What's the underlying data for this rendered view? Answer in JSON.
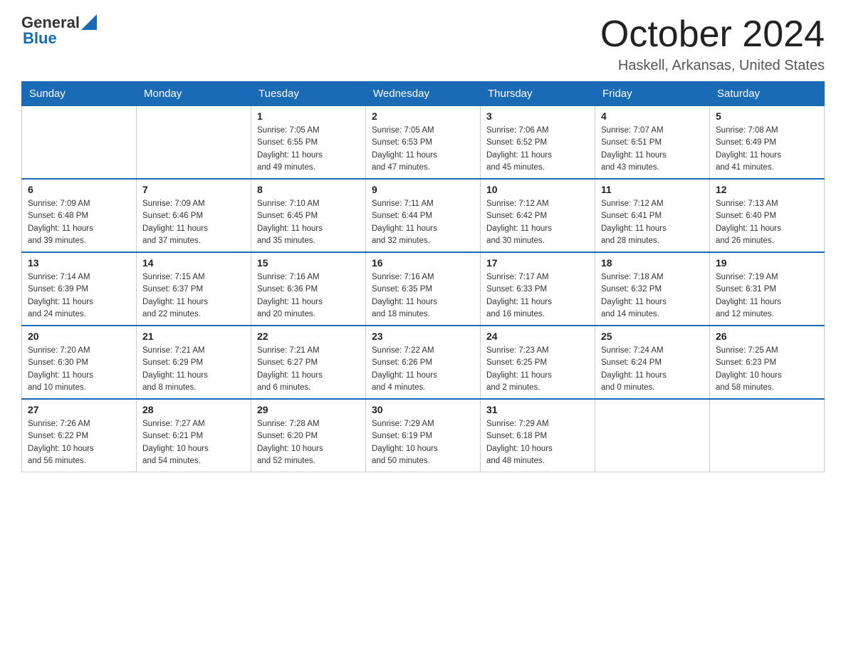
{
  "header": {
    "logo_general": "General",
    "logo_blue": "Blue",
    "month_year": "October 2024",
    "location": "Haskell, Arkansas, United States"
  },
  "weekdays": [
    "Sunday",
    "Monday",
    "Tuesday",
    "Wednesday",
    "Thursday",
    "Friday",
    "Saturday"
  ],
  "weeks": [
    [
      {
        "day": "",
        "info": ""
      },
      {
        "day": "",
        "info": ""
      },
      {
        "day": "1",
        "info": "Sunrise: 7:05 AM\nSunset: 6:55 PM\nDaylight: 11 hours\nand 49 minutes."
      },
      {
        "day": "2",
        "info": "Sunrise: 7:05 AM\nSunset: 6:53 PM\nDaylight: 11 hours\nand 47 minutes."
      },
      {
        "day": "3",
        "info": "Sunrise: 7:06 AM\nSunset: 6:52 PM\nDaylight: 11 hours\nand 45 minutes."
      },
      {
        "day": "4",
        "info": "Sunrise: 7:07 AM\nSunset: 6:51 PM\nDaylight: 11 hours\nand 43 minutes."
      },
      {
        "day": "5",
        "info": "Sunrise: 7:08 AM\nSunset: 6:49 PM\nDaylight: 11 hours\nand 41 minutes."
      }
    ],
    [
      {
        "day": "6",
        "info": "Sunrise: 7:09 AM\nSunset: 6:48 PM\nDaylight: 11 hours\nand 39 minutes."
      },
      {
        "day": "7",
        "info": "Sunrise: 7:09 AM\nSunset: 6:46 PM\nDaylight: 11 hours\nand 37 minutes."
      },
      {
        "day": "8",
        "info": "Sunrise: 7:10 AM\nSunset: 6:45 PM\nDaylight: 11 hours\nand 35 minutes."
      },
      {
        "day": "9",
        "info": "Sunrise: 7:11 AM\nSunset: 6:44 PM\nDaylight: 11 hours\nand 32 minutes."
      },
      {
        "day": "10",
        "info": "Sunrise: 7:12 AM\nSunset: 6:42 PM\nDaylight: 11 hours\nand 30 minutes."
      },
      {
        "day": "11",
        "info": "Sunrise: 7:12 AM\nSunset: 6:41 PM\nDaylight: 11 hours\nand 28 minutes."
      },
      {
        "day": "12",
        "info": "Sunrise: 7:13 AM\nSunset: 6:40 PM\nDaylight: 11 hours\nand 26 minutes."
      }
    ],
    [
      {
        "day": "13",
        "info": "Sunrise: 7:14 AM\nSunset: 6:39 PM\nDaylight: 11 hours\nand 24 minutes."
      },
      {
        "day": "14",
        "info": "Sunrise: 7:15 AM\nSunset: 6:37 PM\nDaylight: 11 hours\nand 22 minutes."
      },
      {
        "day": "15",
        "info": "Sunrise: 7:16 AM\nSunset: 6:36 PM\nDaylight: 11 hours\nand 20 minutes."
      },
      {
        "day": "16",
        "info": "Sunrise: 7:16 AM\nSunset: 6:35 PM\nDaylight: 11 hours\nand 18 minutes."
      },
      {
        "day": "17",
        "info": "Sunrise: 7:17 AM\nSunset: 6:33 PM\nDaylight: 11 hours\nand 16 minutes."
      },
      {
        "day": "18",
        "info": "Sunrise: 7:18 AM\nSunset: 6:32 PM\nDaylight: 11 hours\nand 14 minutes."
      },
      {
        "day": "19",
        "info": "Sunrise: 7:19 AM\nSunset: 6:31 PM\nDaylight: 11 hours\nand 12 minutes."
      }
    ],
    [
      {
        "day": "20",
        "info": "Sunrise: 7:20 AM\nSunset: 6:30 PM\nDaylight: 11 hours\nand 10 minutes."
      },
      {
        "day": "21",
        "info": "Sunrise: 7:21 AM\nSunset: 6:29 PM\nDaylight: 11 hours\nand 8 minutes."
      },
      {
        "day": "22",
        "info": "Sunrise: 7:21 AM\nSunset: 6:27 PM\nDaylight: 11 hours\nand 6 minutes."
      },
      {
        "day": "23",
        "info": "Sunrise: 7:22 AM\nSunset: 6:26 PM\nDaylight: 11 hours\nand 4 minutes."
      },
      {
        "day": "24",
        "info": "Sunrise: 7:23 AM\nSunset: 6:25 PM\nDaylight: 11 hours\nand 2 minutes."
      },
      {
        "day": "25",
        "info": "Sunrise: 7:24 AM\nSunset: 6:24 PM\nDaylight: 11 hours\nand 0 minutes."
      },
      {
        "day": "26",
        "info": "Sunrise: 7:25 AM\nSunset: 6:23 PM\nDaylight: 10 hours\nand 58 minutes."
      }
    ],
    [
      {
        "day": "27",
        "info": "Sunrise: 7:26 AM\nSunset: 6:22 PM\nDaylight: 10 hours\nand 56 minutes."
      },
      {
        "day": "28",
        "info": "Sunrise: 7:27 AM\nSunset: 6:21 PM\nDaylight: 10 hours\nand 54 minutes."
      },
      {
        "day": "29",
        "info": "Sunrise: 7:28 AM\nSunset: 6:20 PM\nDaylight: 10 hours\nand 52 minutes."
      },
      {
        "day": "30",
        "info": "Sunrise: 7:29 AM\nSunset: 6:19 PM\nDaylight: 10 hours\nand 50 minutes."
      },
      {
        "day": "31",
        "info": "Sunrise: 7:29 AM\nSunset: 6:18 PM\nDaylight: 10 hours\nand 48 minutes."
      },
      {
        "day": "",
        "info": ""
      },
      {
        "day": "",
        "info": ""
      }
    ]
  ]
}
